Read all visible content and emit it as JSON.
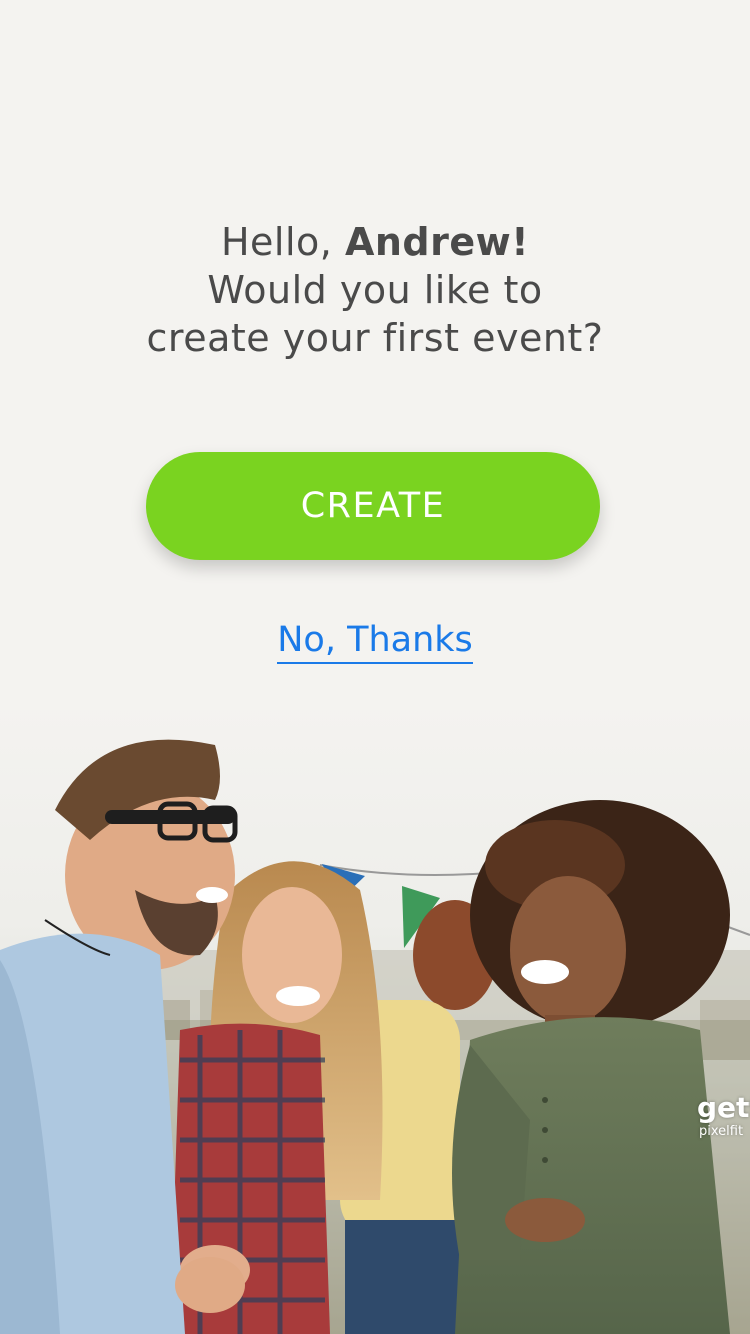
{
  "greeting": {
    "hello": "Hello,",
    "name": "Andrew!",
    "line2": "Would you like to",
    "line3": "create your first event?"
  },
  "actions": {
    "create_label": "CREATE",
    "decline_label": "No, Thanks"
  },
  "photo": {
    "watermark_main": "gett",
    "watermark_sub": "pixelfit"
  },
  "colors": {
    "background": "#f4f3f0",
    "create_button": "#7ad320",
    "link": "#1a7ae8",
    "text": "#4a4a4a"
  }
}
